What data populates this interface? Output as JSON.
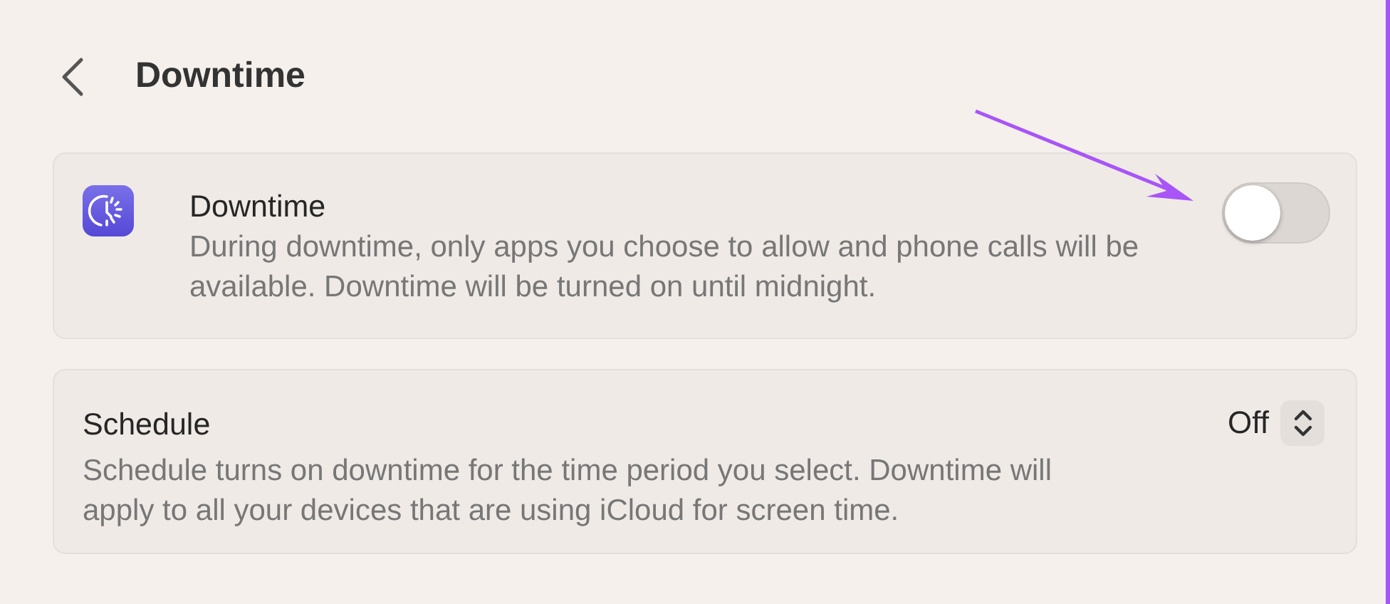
{
  "header": {
    "title": "Downtime"
  },
  "downtime": {
    "title": "Downtime",
    "description": "During downtime, only apps you choose to allow and phone calls will be available. Downtime will be turned on until midnight.",
    "on": false
  },
  "schedule": {
    "title": "Schedule",
    "description": "Schedule turns on downtime for the time period you select. Downtime will apply to all your devices that are using iCloud for screen time.",
    "value": "Off"
  }
}
